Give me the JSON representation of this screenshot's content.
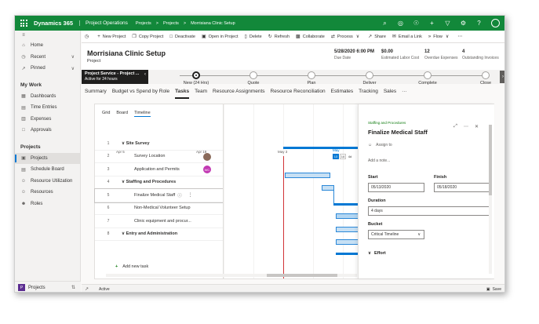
{
  "topbar": {
    "brand": "Dynamics 365",
    "app": "Project Operations",
    "breadcrumbs": [
      "Projects",
      ">",
      "Projects",
      ">",
      "Morrisiana Clinic Setup"
    ],
    "icons": [
      "search-icon",
      "target-icon",
      "lightbulb-icon",
      "plus-icon",
      "filter-icon",
      "gear-icon",
      "help-icon",
      "avatar"
    ]
  },
  "nav": {
    "top_items": [
      {
        "label": "Home",
        "icon": "home-icon"
      },
      {
        "label": "Recent",
        "icon": "clock-icon"
      },
      {
        "label": "Pinned",
        "icon": "pin-icon"
      }
    ],
    "section_mywork": "My Work",
    "mywork_items": [
      "Dashboards",
      "Time Entries",
      "Expenses",
      "Approvals"
    ],
    "section_projects": "Projects",
    "project_items": [
      "Projects",
      "Schedule Board",
      "Resource Utilization",
      "Resources",
      "Roles"
    ],
    "area": "Projects",
    "area_initial": "P"
  },
  "commands": [
    "New Project",
    "Copy Project",
    "Deactivate",
    "Open in Project",
    "Delete",
    "Refresh",
    "Collaborate",
    "Process",
    "Share",
    "Email a Link",
    "Flow"
  ],
  "header": {
    "title": "Morrisiana Clinic Setup",
    "entity": "Project",
    "fields": [
      {
        "value": "5/28/2020 6:00 PM",
        "label": "Due Date"
      },
      {
        "value": "$0.00",
        "label": "Estimated Labor Cost"
      },
      {
        "value": "12",
        "label": "Overdue Expenses"
      },
      {
        "value": "4",
        "label": "Outstanding Invoices"
      }
    ]
  },
  "process": {
    "active_name": "Project Service - Project ...",
    "active_duration": "Active for 24 hours",
    "stages": [
      "New  (24 Hrs)",
      "Quote",
      "Plan",
      "Deliver",
      "Complete",
      "Close"
    ]
  },
  "tabs": [
    "Summary",
    "Budget vs Spend by Role",
    "Tasks",
    "Team",
    "Resource Assignments",
    "Resource Reconciliation",
    "Estimates",
    "Tracking",
    "Sales",
    "···"
  ],
  "view_tabs": [
    "Grid",
    "Board",
    "Timeline"
  ],
  "gantt": {
    "dates": [
      "Apr 5",
      "Apr 19",
      "May 3",
      "May"
    ],
    "mini_cal_month": "May",
    "mini_cal_days": [
      "13",
      "14"
    ],
    "mini_cal_day_header": "4d"
  },
  "tasks": [
    {
      "num": "1",
      "name": "Site Survey",
      "summary": true
    },
    {
      "num": "2",
      "name": "Survey Location",
      "avatar": "photo"
    },
    {
      "num": "3",
      "name": "Application and Permits",
      "avatar": "WC"
    },
    {
      "num": "4",
      "name": "Staffing and Procedures",
      "summary": true
    },
    {
      "num": "5",
      "name": "Finalize Medical Staff"
    },
    {
      "num": "6",
      "name": "Non-Medical Volunteer Setup"
    },
    {
      "num": "7",
      "name": "Clinic equipment and procur..."
    },
    {
      "num": "8",
      "name": "Entry and Administration",
      "summary": true
    }
  ],
  "add_task": "Add new task",
  "details": {
    "bucket_label": "Staffing and Procedures",
    "title": "Finalize Medical Staff",
    "assign": "Assign to",
    "note": "Add a note...",
    "start_label": "Start",
    "start_value": "05/13/2020",
    "finish_label": "Finish",
    "finish_value": "05/18/2020",
    "duration_label": "Duration",
    "duration_value": "4 days",
    "bucket_field_label": "Bucket",
    "bucket_value": "Critical Timeline",
    "effort_label": "Effort"
  },
  "footer": {
    "status": "Active",
    "save": "Save"
  },
  "colors": {
    "brand": "#12883a",
    "accent": "#0078d4",
    "today": "#d13438",
    "wc_avatar": "#c239b3"
  }
}
